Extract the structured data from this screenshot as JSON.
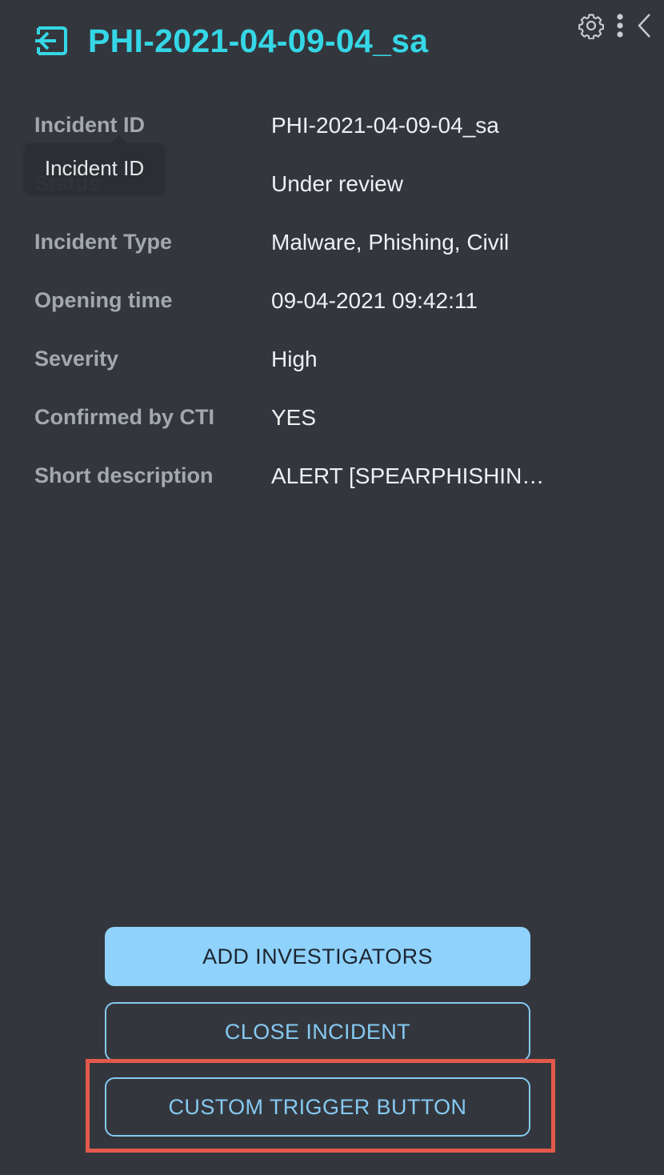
{
  "header": {
    "title": "PHI-2021-04-09-04_sa",
    "icon": "entry-icon",
    "accent_color": "#35d7e6"
  },
  "top_actions": {
    "icons": [
      "gear-icon",
      "kebab-menu-icon",
      "chevron-left-icon"
    ]
  },
  "fields": [
    {
      "label": "Incident ID",
      "value": "PHI-2021-04-09-04_sa"
    },
    {
      "label": "Status",
      "value": "Under review"
    },
    {
      "label": "Incident Type",
      "value": "Malware, Phishing, Civil"
    },
    {
      "label": "Opening time",
      "value": "09-04-2021 09:42:11"
    },
    {
      "label": "Severity",
      "value": "High"
    },
    {
      "label": "Confirmed by CTI",
      "value": "YES"
    },
    {
      "label": "Short description",
      "value": "ALERT [SPEARPHISHIN…"
    }
  ],
  "tooltip": {
    "text": "Incident ID"
  },
  "actions": {
    "add_investigators": "ADD INVESTIGATORS",
    "close_incident": "CLOSE INCIDENT",
    "custom_trigger": "CUSTOM TRIGGER BUTTON"
  },
  "colors": {
    "background": "#33373d",
    "primary_button": "#8fd2fb",
    "outline_button": "#86c9f2",
    "highlight": "#e3594c"
  }
}
